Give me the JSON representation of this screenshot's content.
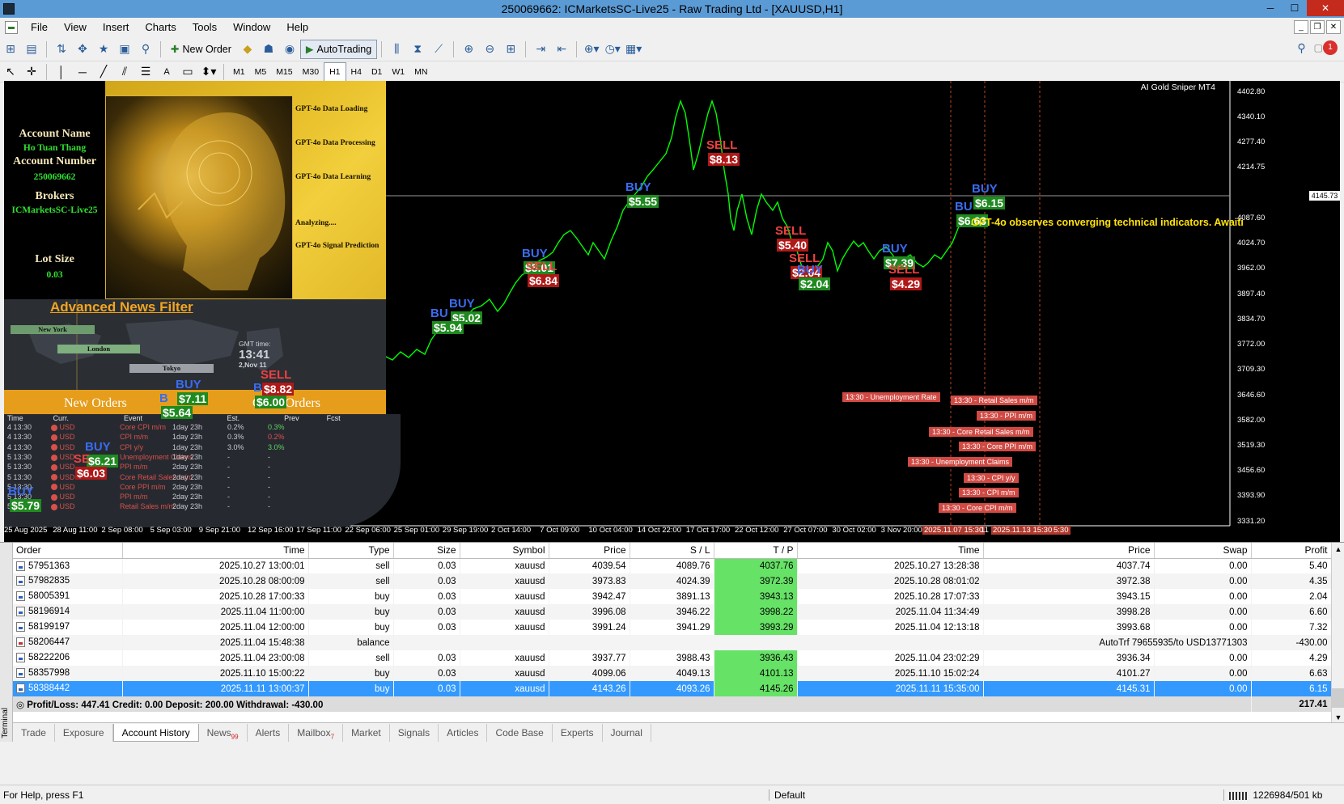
{
  "window": {
    "title": "250069662: ICMarketsSC-Live25 - Raw Trading Ltd - [XAUUSD,H1]",
    "min_btn": "─",
    "max_btn": "☐",
    "close_btn": "✕"
  },
  "menu": [
    "File",
    "View",
    "Insert",
    "Charts",
    "Tools",
    "Window",
    "Help"
  ],
  "toolbar": {
    "new_order": "New Order",
    "autotrading": "AutoTrading",
    "notifications_count": "1"
  },
  "timeframes": [
    "M1",
    "M5",
    "M15",
    "M30",
    "H1",
    "H4",
    "D1",
    "W1",
    "MN"
  ],
  "active_timeframe": "H1",
  "chart": {
    "indicator_name": "AI Gold Sniper MT4",
    "price_ticks": [
      "4402.80",
      "4340.10",
      "4277.40",
      "4214.75",
      "4145.73",
      "4087.60",
      "4024.70",
      "3962.00",
      "3897.40",
      "3834.70",
      "3772.00",
      "3709.30",
      "3646.60",
      "3582.00",
      "3519.30",
      "3456.60",
      "3393.90",
      "3331.20"
    ],
    "current_price": "4145.73",
    "date_ticks": [
      "25 Aug 2025",
      "28 Aug 11:00",
      "2 Sep 08:00",
      "5 Sep 03:00",
      "9 Sep 21:00",
      "12 Sep 16:00",
      "17 Sep 11:00",
      "22 Sep 06:00",
      "25 Sep 01:00",
      "29 Sep 19:00",
      "2 Oct 14:00",
      "7 Oct 09:00",
      "10 Oct 04:00",
      "14 Oct 22:00",
      "17 Oct 17:00",
      "22 Oct 12:00",
      "27 Oct 07:00",
      "30 Oct 02:00",
      "3 Nov 20:00"
    ],
    "date_markers": [
      "2025.11.07 15:30",
      "11",
      "2025.11.13 15:30",
      "5:30"
    ],
    "ai_comment": "GPT-4o observes converging technical indicators. Awaiti",
    "signals": [
      {
        "side": "SELL",
        "value": "$8.13"
      },
      {
        "side": "BUY",
        "value": "$5.55"
      },
      {
        "side": "BUY",
        "value": "$6.15"
      },
      {
        "side": "BU",
        "value": "$6.63"
      },
      {
        "side": "SELL",
        "value": "$5.40"
      },
      {
        "side": "SELL",
        "value": "$2.04"
      },
      {
        "side": "BUY",
        "value": "$2.04"
      },
      {
        "side": "BUY",
        "value": "$7.39"
      },
      {
        "side": "SELL",
        "value": "$4.29"
      },
      {
        "side": "BUY",
        "value": "$5.01"
      },
      {
        "side": "SELL",
        "value": "$6.84"
      },
      {
        "side": "BUY",
        "value": "$5.02"
      },
      {
        "side": "BU",
        "value": "$5.94"
      },
      {
        "side": "BUY",
        "value": "$7.11"
      },
      {
        "side": "SELL",
        "value": "$8.82"
      },
      {
        "side": "B",
        "value": "$5.64"
      },
      {
        "side": "B",
        "value": "$6.00"
      },
      {
        "side": "BUY",
        "value": "$6.21"
      },
      {
        "side": "SE",
        "value": "$6.03"
      },
      {
        "side": "BUY",
        "value": "$5.79"
      }
    ],
    "news_tags": [
      "13:30 - Unemployment Rate",
      "13:30 - Retail Sales m/m",
      "13:30 - PPI m/m",
      "13:30 - Core Retail Sales m/m",
      "13:30 - Core PPI m/m",
      "13:30 - Unemployment Claims",
      "13:30 - CPI y/y",
      "13:30 - CPI m/m",
      "13:30 - Core CPI m/m"
    ]
  },
  "ea": {
    "account_name_label": "Account Name",
    "account_name": "Ho Tuan Thang",
    "account_number_label": "Account Number",
    "account_number": "250069662",
    "brokers_label": "Brokers",
    "broker": "ICMarketsSC-Live25",
    "lot_size_label": "Lot Size",
    "lot_size": "0.03",
    "steps": [
      "GPT-4o Data Loading",
      "GPT-4o Data Processing",
      "GPT-4o Data Learning",
      "Analyzing....",
      "GPT-4o Signal Prediction"
    ],
    "news_filter_title": "Advanced News Filter",
    "sessions": [
      "New York",
      "London",
      "Tokyo"
    ],
    "gmt_label": "GMT time:",
    "gmt_time": "13:41",
    "gmt_date": "2,Nov 11",
    "new_orders": "New Orders",
    "close_orders": "Close Orders",
    "news_headers": [
      "Time",
      "Curr.",
      "Event",
      "Est.",
      "Prev",
      "Fcst"
    ],
    "news_rows": [
      {
        "time": "4 13:30",
        "curr": "USD",
        "event": "Core CPI m/m",
        "est": "1day 23h",
        "prev": "0.2%",
        "fcst": "0.3%"
      },
      {
        "time": "4 13:30",
        "curr": "USD",
        "event": "CPI m/m",
        "est": "1day 23h",
        "prev": "0.3%",
        "fcst": "0.2%"
      },
      {
        "time": "4 13:30",
        "curr": "USD",
        "event": "CPI y/y",
        "est": "1day 23h",
        "prev": "3.0%",
        "fcst": "3.0%"
      },
      {
        "time": "5 13:30",
        "curr": "USD",
        "event": "Unemployment Claims",
        "est": "1day 23h",
        "prev": "-",
        "fcst": "-"
      },
      {
        "time": "5 13:30",
        "curr": "USD",
        "event": "PPI m/m",
        "est": "2day 23h",
        "prev": "-",
        "fcst": "-"
      },
      {
        "time": "5 13:30",
        "curr": "USD",
        "event": "Core Retail Sales m/m",
        "est": "2day 23h",
        "prev": "-",
        "fcst": "-"
      },
      {
        "time": "5 13:30",
        "curr": "USD",
        "event": "Core PPI m/m",
        "est": "2day 23h",
        "prev": "-",
        "fcst": "-"
      },
      {
        "time": "5 13:30",
        "curr": "USD",
        "event": "PPI m/m",
        "est": "2day 23h",
        "prev": "-",
        "fcst": "-"
      },
      {
        "time": "5 13:30",
        "curr": "USD",
        "event": "Retail Sales m/m",
        "est": "2day 23h",
        "prev": "-",
        "fcst": "-"
      }
    ]
  },
  "history": {
    "columns": [
      "Order",
      "Time",
      "Type",
      "Size",
      "Symbol",
      "Price",
      "S / L",
      "T / P",
      "Time",
      "Price",
      "Swap",
      "Profit"
    ],
    "rows": [
      {
        "order": "57951363",
        "time": "2025.10.27 13:00:01",
        "type": "sell",
        "size": "0.03",
        "symbol": "xauusd",
        "price": "4039.54",
        "sl": "4089.76",
        "tp": "4037.76",
        "ctime": "2025.10.27 13:28:38",
        "cprice": "4037.74",
        "swap": "0.00",
        "profit": "5.40"
      },
      {
        "order": "57982835",
        "time": "2025.10.28 08:00:09",
        "type": "sell",
        "size": "0.03",
        "symbol": "xauusd",
        "price": "3973.83",
        "sl": "4024.39",
        "tp": "3972.39",
        "ctime": "2025.10.28 08:01:02",
        "cprice": "3972.38",
        "swap": "0.00",
        "profit": "4.35"
      },
      {
        "order": "58005391",
        "time": "2025.10.28 17:00:33",
        "type": "buy",
        "size": "0.03",
        "symbol": "xauusd",
        "price": "3942.47",
        "sl": "3891.13",
        "tp": "3943.13",
        "ctime": "2025.10.28 17:07:33",
        "cprice": "3943.15",
        "swap": "0.00",
        "profit": "2.04"
      },
      {
        "order": "58196914",
        "time": "2025.11.04 11:00:00",
        "type": "buy",
        "size": "0.03",
        "symbol": "xauusd",
        "price": "3996.08",
        "sl": "3946.22",
        "tp": "3998.22",
        "ctime": "2025.11.04 11:34:49",
        "cprice": "3998.28",
        "swap": "0.00",
        "profit": "6.60"
      },
      {
        "order": "58199197",
        "time": "2025.11.04 12:00:00",
        "type": "buy",
        "size": "0.03",
        "symbol": "xauusd",
        "price": "3991.24",
        "sl": "3941.29",
        "tp": "3993.29",
        "ctime": "2025.11.04 12:13:18",
        "cprice": "3993.68",
        "swap": "0.00",
        "profit": "7.32"
      },
      {
        "order": "58206447",
        "time": "2025.11.04 15:48:38",
        "type": "balance",
        "size": "",
        "symbol": "",
        "price": "",
        "sl": "",
        "tp": "",
        "ctime": "",
        "cprice": "AutoTrf 79655935/to USD13771303",
        "swap": "",
        "profit": "-430.00"
      },
      {
        "order": "58222206",
        "time": "2025.11.04 23:00:08",
        "type": "sell",
        "size": "0.03",
        "symbol": "xauusd",
        "price": "3937.77",
        "sl": "3988.43",
        "tp": "3936.43",
        "ctime": "2025.11.04 23:02:29",
        "cprice": "3936.34",
        "swap": "0.00",
        "profit": "4.29"
      },
      {
        "order": "58357998",
        "time": "2025.11.10 15:00:22",
        "type": "buy",
        "size": "0.03",
        "symbol": "xauusd",
        "price": "4099.06",
        "sl": "4049.13",
        "tp": "4101.13",
        "ctime": "2025.11.10 15:02:24",
        "cprice": "4101.27",
        "swap": "0.00",
        "profit": "6.63"
      },
      {
        "order": "58388442",
        "time": "2025.11.11 13:00:37",
        "type": "buy",
        "size": "0.03",
        "symbol": "xauusd",
        "price": "4143.26",
        "sl": "4093.26",
        "tp": "4145.26",
        "ctime": "2025.11.11 15:35:00",
        "cprice": "4145.31",
        "swap": "0.00",
        "profit": "6.15"
      }
    ],
    "summary": "Profit/Loss: 447.41  Credit: 0.00  Deposit: 200.00  Withdrawal: -430.00",
    "summary_total": "217.41"
  },
  "terminal_label": "Terminal",
  "tabs": [
    {
      "label": "Trade",
      "badge": ""
    },
    {
      "label": "Exposure",
      "badge": ""
    },
    {
      "label": "Account History",
      "badge": ""
    },
    {
      "label": "News",
      "badge": "99"
    },
    {
      "label": "Alerts",
      "badge": ""
    },
    {
      "label": "Mailbox",
      "badge": "7"
    },
    {
      "label": "Market",
      "badge": ""
    },
    {
      "label": "Signals",
      "badge": ""
    },
    {
      "label": "Articles",
      "badge": ""
    },
    {
      "label": "Code Base",
      "badge": ""
    },
    {
      "label": "Experts",
      "badge": ""
    },
    {
      "label": "Journal",
      "badge": ""
    }
  ],
  "active_tab": "Account History",
  "status": {
    "help": "For Help, press F1",
    "profile": "Default",
    "traffic": "1226984/501 kb"
  },
  "colors": {
    "chart_bg": "#000000",
    "candle": "#00ff00",
    "buy": "#3a6cf0",
    "sell": "#f04040",
    "tp_cell": "#66e266",
    "selected_row": "#3399ff"
  }
}
